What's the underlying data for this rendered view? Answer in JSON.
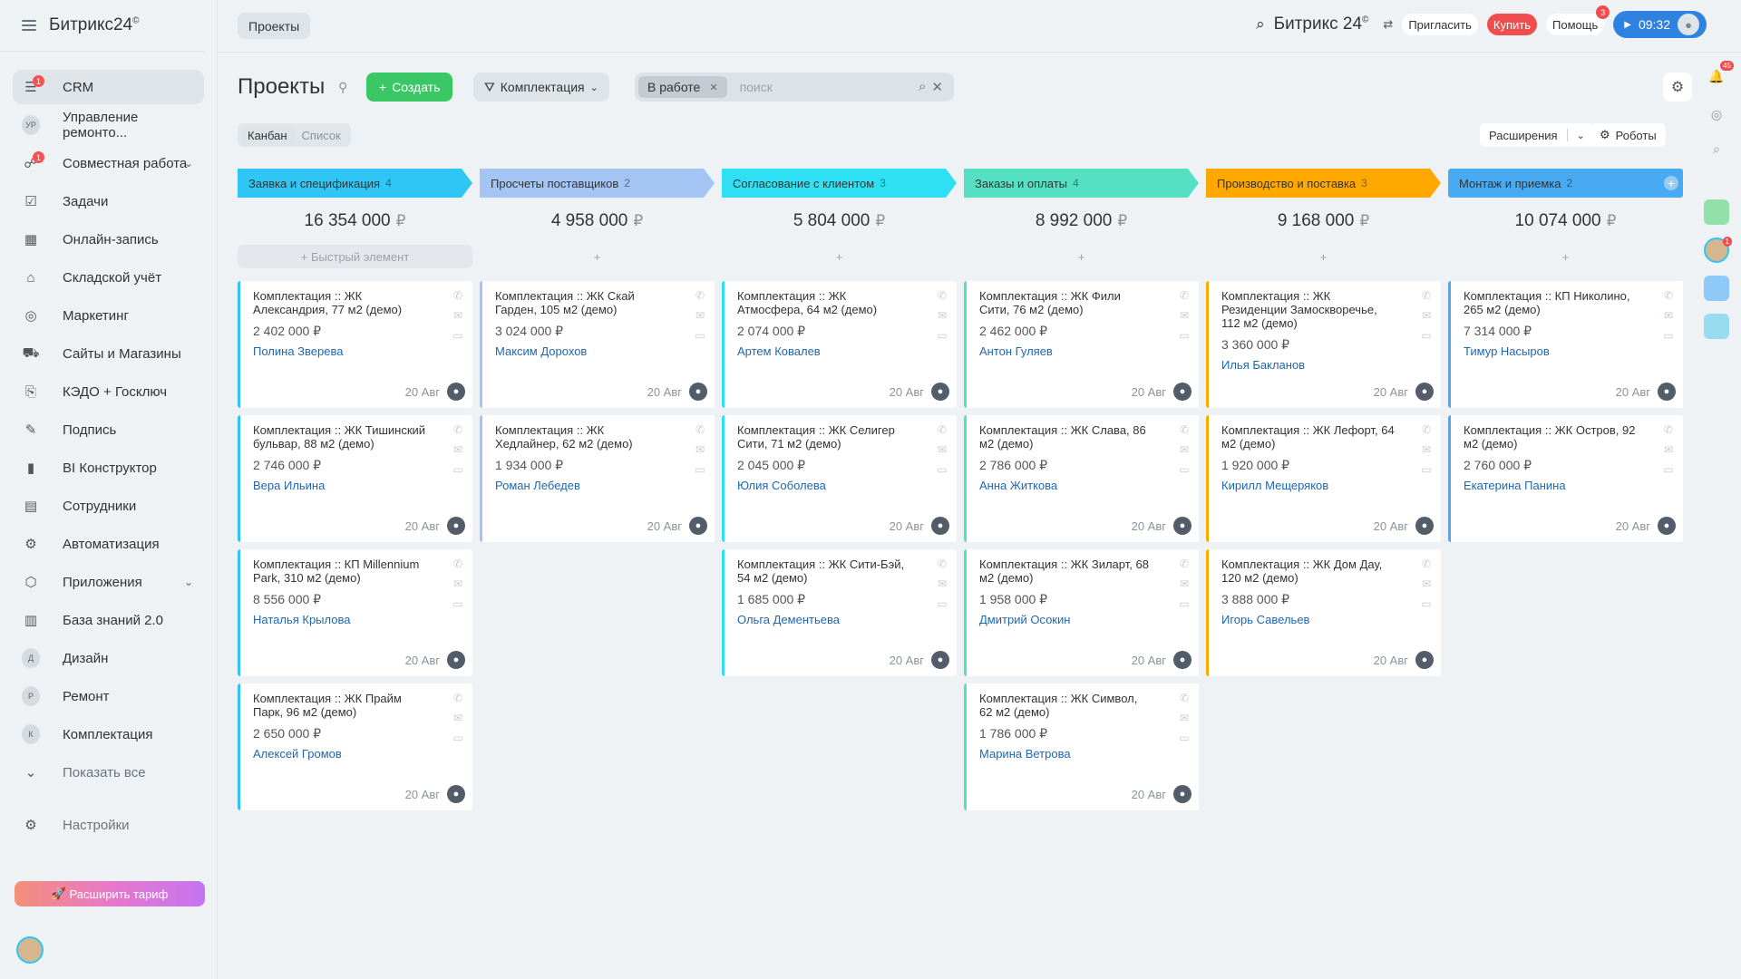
{
  "app": {
    "logo": "Битрикс24",
    "logo_mark": "©"
  },
  "sidebar": {
    "items": [
      {
        "key": "crm",
        "label": "CRM",
        "icon": "☰",
        "badge": "1",
        "active": true
      },
      {
        "key": "remont-mgmt",
        "label": "Управление ремонто...",
        "avatar": "УР"
      },
      {
        "key": "collab",
        "label": "Совместная работа",
        "icon": "☍",
        "badge": "1",
        "chevron": true
      },
      {
        "key": "tasks",
        "label": "Задачи",
        "icon": "☑"
      },
      {
        "key": "booking",
        "label": "Онлайн-запись",
        "icon": "▦"
      },
      {
        "key": "warehouse",
        "label": "Складской учёт",
        "icon": "⌂"
      },
      {
        "key": "marketing",
        "label": "Маркетинг",
        "icon": "◎"
      },
      {
        "key": "sites",
        "label": "Сайты и Магазины",
        "icon": "⛟"
      },
      {
        "key": "kedo",
        "label": "КЭДО + Госключ",
        "icon": "⎘"
      },
      {
        "key": "sign",
        "label": "Подпись",
        "icon": "✎"
      },
      {
        "key": "bi",
        "label": "BI Конструктор",
        "icon": "▮"
      },
      {
        "key": "staff",
        "label": "Сотрудники",
        "icon": "▤"
      },
      {
        "key": "automation",
        "label": "Автоматизация",
        "icon": "⚙"
      },
      {
        "key": "apps",
        "label": "Приложения",
        "icon": "⬡",
        "chevron": true
      },
      {
        "key": "kb",
        "label": "База знаний 2.0",
        "icon": "▥"
      },
      {
        "key": "design",
        "label": "Дизайн",
        "avatar": "Д"
      },
      {
        "key": "remont",
        "label": "Ремонт",
        "avatar": "Р"
      },
      {
        "key": "komplekt",
        "label": "Комплектация",
        "avatar": "К"
      },
      {
        "key": "show-all",
        "label": "Показать все",
        "icon": "⌄",
        "muted": true
      }
    ],
    "settings": "Настройки",
    "upgrade": "Расширить тариф"
  },
  "topbar": {
    "tab": "Проекты",
    "brand": "Битрикс 24",
    "brand_mark": "©",
    "invite": "Пригласить",
    "buy": "Купить",
    "help": "Помощь",
    "help_count": "3",
    "time": "09:32"
  },
  "toolbar": {
    "title": "Проекты",
    "create": "Создать",
    "pipeline": "Комплектация",
    "filter_chip": "В работе",
    "search_placeholder": "поиск",
    "view_kanban": "Канбан",
    "view_list": "Список",
    "extensions": "Расширения",
    "robots": "Роботы"
  },
  "rail": {
    "notif_count": "45",
    "chat_count": "1"
  },
  "kanban": {
    "quick_add": "Быстрый элемент",
    "currency": "₽",
    "columns": [
      {
        "name": "Заявка и спецификация",
        "count": "4",
        "total": "16 354 000",
        "color": "#2fc6f6",
        "cards": [
          {
            "title": "Комплектация :: ЖК Александрия, 77 м2 (демо)",
            "price": "2 402 000 ₽",
            "manager": "Полина Зверева",
            "date": "20 Авг"
          },
          {
            "title": "Комплектация :: ЖК Тишинский бульвар, 88 м2 (демо)",
            "price": "2 746 000 ₽",
            "manager": "Вера Ильина",
            "date": "20 Авг"
          },
          {
            "title": "Комплектация :: КП Millennium Park, 310 м2 (демо)",
            "price": "8 556 000 ₽",
            "manager": "Наталья Крылова",
            "date": "20 Авг"
          },
          {
            "title": "Комплектация :: ЖК Прайм Парк, 96 м2 (демо)",
            "price": "2 650 000 ₽",
            "manager": "Алексей Громов",
            "date": "20 Авг"
          }
        ]
      },
      {
        "name": "Просчеты поставщиков",
        "count": "2",
        "total": "4 958 000",
        "color": "#a4c4f4",
        "cards": [
          {
            "title": "Комплектация :: ЖК Скай Гарден, 105 м2 (демо)",
            "price": "3 024 000 ₽",
            "manager": "Максим Дорохов",
            "date": "20 Авг"
          },
          {
            "title": "Комплектация :: ЖК Хедлайнер, 62 м2 (демо)",
            "price": "1 934 000 ₽",
            "manager": "Роман Лебедев",
            "date": "20 Авг"
          }
        ]
      },
      {
        "name": "Согласование с клиентом",
        "count": "3",
        "total": "5 804 000",
        "color": "#2fe0f5",
        "cards": [
          {
            "title": "Комплектация :: ЖК Атмосфера, 64 м2 (демо)",
            "price": "2 074 000 ₽",
            "manager": "Артем Ковалев",
            "date": "20 Авг"
          },
          {
            "title": "Комплектация :: ЖК Селигер Сити, 71 м2 (демо)",
            "price": "2 045 000 ₽",
            "manager": "Юлия Соболева",
            "date": "20 Авг"
          },
          {
            "title": "Комплектация :: ЖК Сити-Бэй, 54 м2 (демо)",
            "price": "1 685 000 ₽",
            "manager": "Ольга Дементьева",
            "date": "20 Авг"
          }
        ]
      },
      {
        "name": "Заказы и оплаты",
        "count": "4",
        "total": "8 992 000",
        "color": "#55e0c4",
        "cards": [
          {
            "title": "Комплектация :: ЖК Фили Сити, 76 м2 (демо)",
            "price": "2 462 000 ₽",
            "manager": "Антон Гуляев",
            "date": "20 Авг"
          },
          {
            "title": "Комплектация :: ЖК Слава, 86 м2 (демо)",
            "price": "2 786 000 ₽",
            "manager": "Анна Житкова",
            "date": "20 Авг"
          },
          {
            "title": "Комплектация :: ЖК Зиларт, 68 м2 (демо)",
            "price": "1 958 000 ₽",
            "manager": "Дмитрий Осокин",
            "date": "20 Авг"
          },
          {
            "title": "Комплектация :: ЖК Символ, 62 м2 (демо)",
            "price": "1 786 000 ₽",
            "manager": "Марина Ветрова",
            "date": "20 Авг"
          }
        ]
      },
      {
        "name": "Производство и поставка",
        "count": "3",
        "total": "9 168 000",
        "color": "#ffa900",
        "cards": [
          {
            "title": "Комплектация :: ЖК Резиденции Замоскворечье, 112 м2 (демо)",
            "price": "3 360 000 ₽",
            "manager": "Илья Бакланов",
            "date": "20 Авг"
          },
          {
            "title": "Комплектация :: ЖК Лефорт, 64 м2 (демо)",
            "price": "1 920 000 ₽",
            "manager": "Кирилл Мещеряков",
            "date": "20 Авг"
          },
          {
            "title": "Комплектация :: ЖК Дом Дау, 120 м2 (демо)",
            "price": "3 888 000 ₽",
            "manager": "Игорь Савельев",
            "date": "20 Авг"
          }
        ]
      },
      {
        "name": "Монтаж и приемка",
        "count": "2",
        "total": "10 074 000",
        "color": "#47aaf2",
        "cards": [
          {
            "title": "Комплектация :: КП Николино, 265 м2 (демо)",
            "price": "7 314 000 ₽",
            "manager": "Тимур Насыров",
            "date": "20 Авг"
          },
          {
            "title": "Комплектация :: ЖК Остров, 92 м2 (демо)",
            "price": "2 760 000 ₽",
            "manager": "Екатерина Панина",
            "date": "20 Авг"
          }
        ]
      }
    ]
  }
}
